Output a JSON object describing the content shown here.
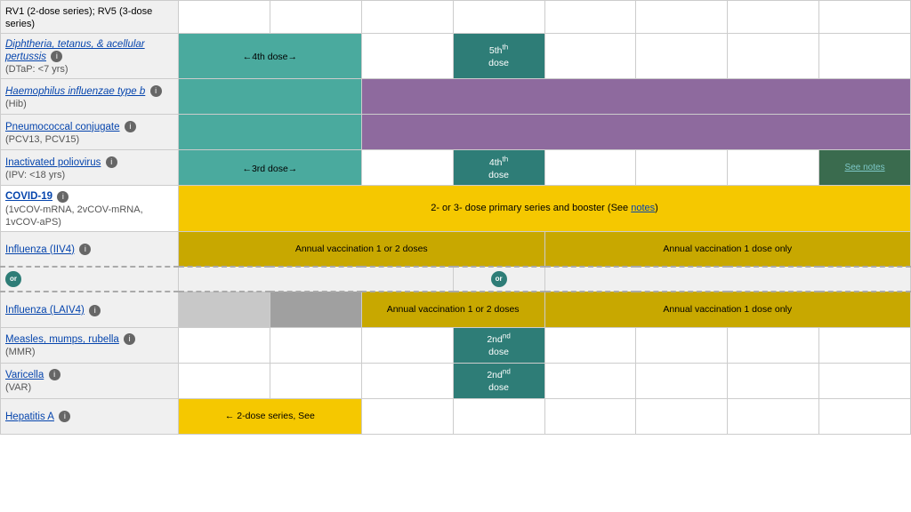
{
  "vaccines": [
    {
      "id": "rv",
      "name_link": null,
      "name_text": "RV1 (2-dose series); RV5 (3-dose series)",
      "italic": false,
      "info": false,
      "sub": null,
      "row_type": "header_partial"
    },
    {
      "id": "dtap",
      "name_link": "Diphtheria, tetanus, & acellular pertussis",
      "italic": false,
      "info": true,
      "sub": "(DTaP: <7 yrs)",
      "row_type": "dtap"
    },
    {
      "id": "hib",
      "name_link": "Haemophilus influenzae type b",
      "italic": true,
      "info": true,
      "sub": "(Hib)",
      "row_type": "hib"
    },
    {
      "id": "pcv",
      "name_link": "Pneumococcal conjugate",
      "italic": false,
      "info": true,
      "sub": "(PCV13, PCV15)",
      "row_type": "pcv"
    },
    {
      "id": "ipv",
      "name_link": "Inactivated poliovirus",
      "italic": false,
      "info": true,
      "sub": "(IPV: <18 yrs)",
      "row_type": "ipv"
    },
    {
      "id": "covid",
      "name_link": "COVID-19",
      "italic": false,
      "info": true,
      "sub": "(1vCOV-mRNA, 2vCOV-mRNA, 1vCOV-aPS)",
      "row_type": "covid"
    },
    {
      "id": "iiv4",
      "name_link": "Influenza (IIV4)",
      "italic": false,
      "info": true,
      "sub": null,
      "row_type": "iiv4"
    },
    {
      "id": "laiv4",
      "name_link": "Influenza (LAIV4)",
      "italic": false,
      "info": true,
      "sub": null,
      "row_type": "laiv4"
    },
    {
      "id": "mmr",
      "name_link": "Measles, mumps, rubella",
      "italic": false,
      "info": true,
      "sub": "(MMR)",
      "row_type": "mmr"
    },
    {
      "id": "varicella",
      "name_link": "Varicella",
      "italic": false,
      "info": true,
      "sub": "(VAR)",
      "row_type": "varicella"
    },
    {
      "id": "hepa",
      "name_link": "Hepatitis A",
      "italic": false,
      "info": true,
      "sub": null,
      "row_type": "hepa"
    }
  ],
  "labels": {
    "rv_text": "RV1 (2-dose series); RV5 (3-dose series)",
    "dtap_arrow": "←4th dose→",
    "dtap_5th": "5th",
    "dtap_dose": "dose",
    "hib_label": "",
    "ipv_arrow": "←3rd dose→",
    "ipv_4th": "4th",
    "ipv_dose": "dose",
    "ipv_seenotes": "See notes",
    "covid_span": "2- or 3- dose primary series and booster (See notes)",
    "iiv4_annual1": "Annual vaccination 1 or 2 doses",
    "iiv4_annual2": "Annual vaccination 1 dose only",
    "laiv4_annual1": "Annual vaccination 1 or 2 doses",
    "laiv4_annual2": "Annual vaccination 1 dose only",
    "mmr_2nd": "2nd",
    "mmr_dose": "dose",
    "var_2nd": "2nd",
    "var_dose": "dose",
    "hepa_text": "← 2-dose series, See",
    "or_label": "or",
    "notes_link": "notes"
  }
}
